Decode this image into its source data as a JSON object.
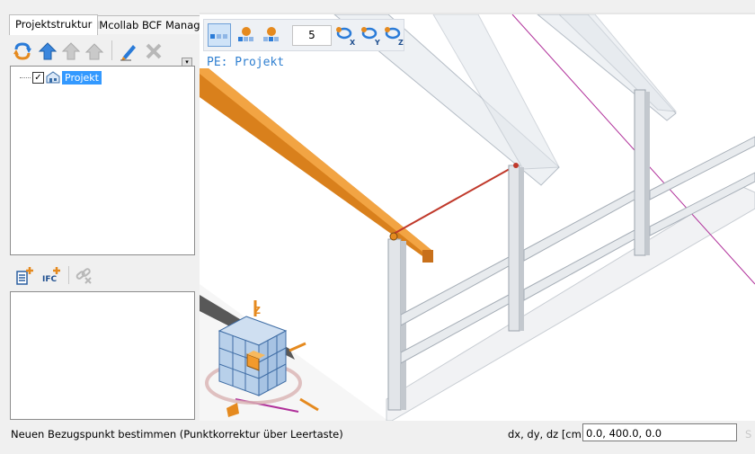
{
  "left_panel": {
    "tabs": [
      {
        "label": "Projektstruktur",
        "active": true
      },
      {
        "label": "BIMcollab BCF Manager",
        "active": false
      }
    ],
    "toolbar_icons": [
      "refresh-icon",
      "up-arrow-icon",
      "up-arrow-disabled-icon",
      "home-disabled-icon",
      "edit-pencil-icon",
      "delete-x-icon"
    ],
    "tree": {
      "root_label": "Projekt",
      "checked": true
    },
    "lower_toolbar_icons": [
      "add-list-icon",
      "add-ifc-icon",
      "unlink-disabled-icon"
    ],
    "ifc_label": "IFC"
  },
  "viewport": {
    "toolbar": {
      "number_value": "5",
      "axis_labels": [
        "X",
        "Y",
        "Z"
      ]
    },
    "plane_label": "PE: Projekt",
    "cube_axis_label": "Z"
  },
  "status_bar": {
    "message": "Neuen Bezugspunkt bestimmen (Punktkorrektur über Leertaste)",
    "input_label": "dx, dy, dz [cm]",
    "input_value": "0.0, 400.0, 0.0",
    "ghost_text": "S"
  },
  "colors": {
    "accent_blue": "#3399ff",
    "beam_orange": "#e58a1f",
    "rail_grey": "#d9dde2",
    "guide_red": "#c0392b",
    "guide_magenta": "#b0309a"
  }
}
